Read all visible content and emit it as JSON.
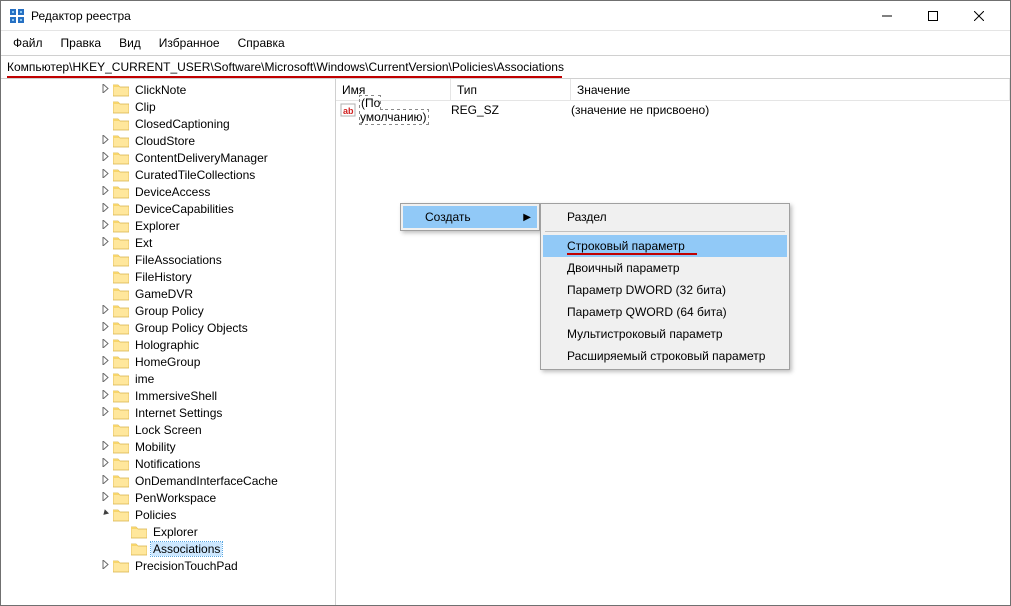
{
  "window": {
    "title": "Редактор реестра"
  },
  "menu": [
    "Файл",
    "Правка",
    "Вид",
    "Избранное",
    "Справка"
  ],
  "address": "Компьютер\\HKEY_CURRENT_USER\\Software\\Microsoft\\Windows\\CurrentVersion\\Policies\\Associations",
  "tree": [
    {
      "label": "ClickNote",
      "exp": "closed"
    },
    {
      "label": "Clip",
      "exp": "none"
    },
    {
      "label": "ClosedCaptioning",
      "exp": "none"
    },
    {
      "label": "CloudStore",
      "exp": "closed"
    },
    {
      "label": "ContentDeliveryManager",
      "exp": "closed"
    },
    {
      "label": "CuratedTileCollections",
      "exp": "closed"
    },
    {
      "label": "DeviceAccess",
      "exp": "closed"
    },
    {
      "label": "DeviceCapabilities",
      "exp": "closed"
    },
    {
      "label": "Explorer",
      "exp": "closed"
    },
    {
      "label": "Ext",
      "exp": "closed"
    },
    {
      "label": "FileAssociations",
      "exp": "none"
    },
    {
      "label": "FileHistory",
      "exp": "none"
    },
    {
      "label": "GameDVR",
      "exp": "none"
    },
    {
      "label": "Group Policy",
      "exp": "closed"
    },
    {
      "label": "Group Policy Objects",
      "exp": "closed"
    },
    {
      "label": "Holographic",
      "exp": "closed"
    },
    {
      "label": "HomeGroup",
      "exp": "closed"
    },
    {
      "label": "ime",
      "exp": "closed"
    },
    {
      "label": "ImmersiveShell",
      "exp": "closed"
    },
    {
      "label": "Internet Settings",
      "exp": "closed"
    },
    {
      "label": "Lock Screen",
      "exp": "none"
    },
    {
      "label": "Mobility",
      "exp": "closed"
    },
    {
      "label": "Notifications",
      "exp": "closed"
    },
    {
      "label": "OnDemandInterfaceCache",
      "exp": "closed"
    },
    {
      "label": "PenWorkspace",
      "exp": "closed"
    },
    {
      "label": "Policies",
      "exp": "open"
    },
    {
      "label": "Explorer",
      "exp": "none",
      "depth": 1
    },
    {
      "label": "Associations",
      "exp": "none",
      "depth": 1,
      "selected": true
    },
    {
      "label": "PrecisionTouchPad",
      "exp": "closed"
    }
  ],
  "list": {
    "headers": {
      "name": "Имя",
      "type": "Тип",
      "value": "Значение"
    },
    "rows": [
      {
        "name": "(По умолчанию)",
        "type": "REG_SZ",
        "value": "(значение не присвоено)"
      }
    ]
  },
  "context": {
    "parent": {
      "label": "Создать"
    },
    "sub": [
      {
        "label": "Раздел",
        "sep_after": true
      },
      {
        "label": "Строковый параметр",
        "hl": true,
        "underline": true
      },
      {
        "label": "Двоичный параметр"
      },
      {
        "label": "Параметр DWORD (32 бита)"
      },
      {
        "label": "Параметр QWORD (64 бита)"
      },
      {
        "label": "Мультистроковый параметр"
      },
      {
        "label": "Расширяемый строковый параметр"
      }
    ]
  }
}
